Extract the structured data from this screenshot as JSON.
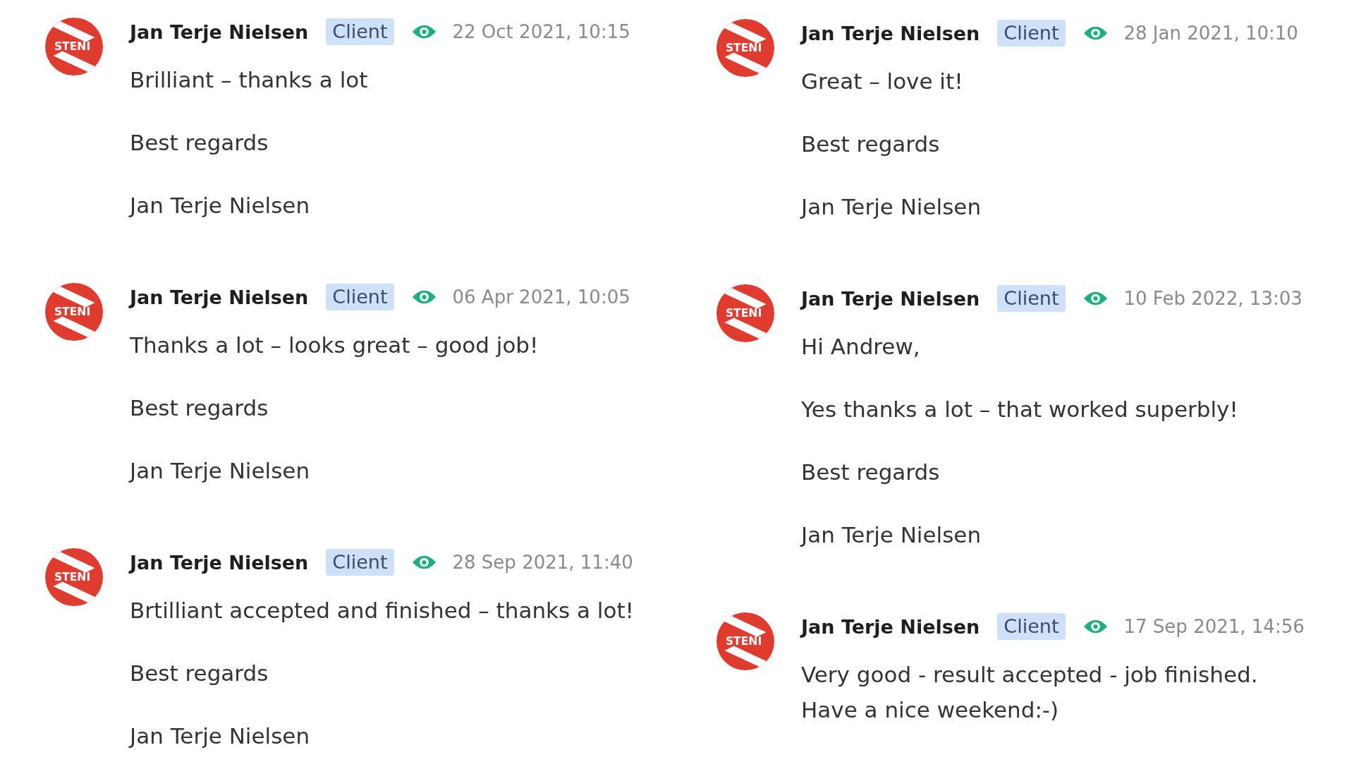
{
  "columns": [
    {
      "messages": [
        {
          "avatar_text": "STENI",
          "author": "Jan Terje Nielsen",
          "role": "Client",
          "timestamp": "22 Oct 2021, 10:15",
          "paragraphs": [
            [
              "Brilliant – thanks a lot"
            ],
            [
              "Best regards"
            ],
            [
              "Jan Terje Nielsen"
            ]
          ]
        },
        {
          "avatar_text": "STENI",
          "author": "Jan Terje Nielsen",
          "role": "Client",
          "timestamp": "06 Apr 2021, 10:05",
          "paragraphs": [
            [
              "Thanks a lot – looks great – good job!"
            ],
            [
              "Best regards"
            ],
            [
              "Jan Terje Nielsen"
            ]
          ]
        },
        {
          "avatar_text": "STENI",
          "author": "Jan Terje Nielsen",
          "role": "Client",
          "timestamp": "28 Sep 2021, 11:40",
          "paragraphs": [
            [
              "Brtilliant accepted and finished – thanks a lot!"
            ],
            [
              "Best regards"
            ],
            [
              "Jan Terje Nielsen"
            ]
          ]
        }
      ]
    },
    {
      "messages": [
        {
          "avatar_text": "STENI",
          "author": "Jan Terje Nielsen",
          "role": "Client",
          "timestamp": "28 Jan 2021, 10:10",
          "paragraphs": [
            [
              "Great – love it!"
            ],
            [
              "Best regards"
            ],
            [
              "Jan Terje Nielsen"
            ]
          ]
        },
        {
          "avatar_text": "STENI",
          "author": "Jan Terje Nielsen",
          "role": "Client",
          "timestamp": "10 Feb 2022, 13:03",
          "paragraphs": [
            [
              "Hi Andrew,"
            ],
            [
              "Yes thanks a lot – that worked superbly!"
            ],
            [
              "Best regards"
            ],
            [
              "Jan Terje Nielsen"
            ]
          ]
        },
        {
          "avatar_text": "STENI",
          "author": "Jan Terje Nielsen",
          "role": "Client",
          "timestamp": "17 Sep 2021, 14:56",
          "paragraphs": [
            [
              "Very good - result accepted - job finished.",
              "Have a nice weekend:-)"
            ]
          ]
        }
      ]
    }
  ]
}
